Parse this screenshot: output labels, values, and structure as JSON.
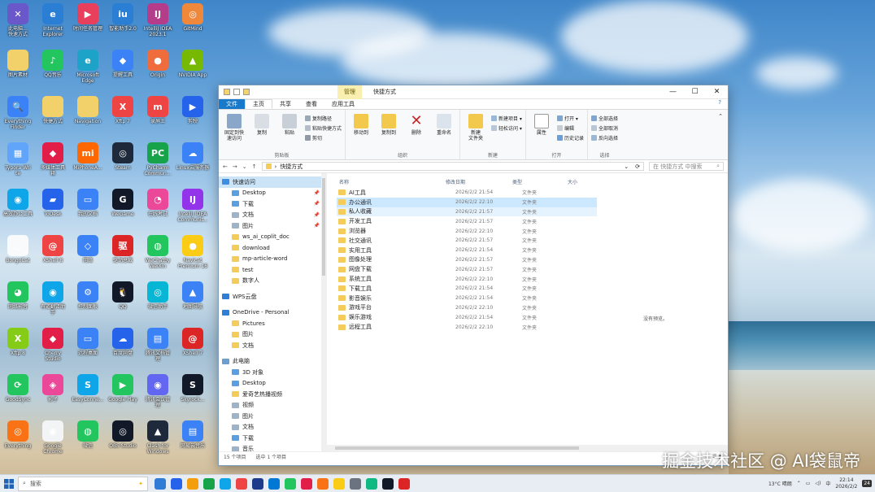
{
  "desktop_icons": [
    {
      "label": "此电脑…\n快速方式",
      "color": "#6a57c9",
      "glyph": "✕"
    },
    {
      "label": "Internet\nExplorer",
      "color": "#2a7fd4",
      "glyph": "e"
    },
    {
      "label": "时间任务管理",
      "color": "#e8405c",
      "glyph": "▶"
    },
    {
      "label": "智能助手2.0",
      "color": "#2a7fd4",
      "glyph": "iu"
    },
    {
      "label": "IntelliJ IDEA\n2023.1",
      "color": "#b43c8a",
      "glyph": "IJ"
    },
    {
      "label": "GitMind",
      "color": "#f0883c",
      "glyph": "◎"
    },
    {
      "label": "图片素材",
      "color": "#f2d16b",
      "glyph": ""
    },
    {
      "label": "QQ音乐",
      "color": "#22c55e",
      "glyph": "♪"
    },
    {
      "label": "Microsoft\nEdge",
      "color": "#1ea3c8",
      "glyph": "e"
    },
    {
      "label": "提醒工具",
      "color": "#3b82f6",
      "glyph": "◆"
    },
    {
      "label": "Origin",
      "color": "#ef6c3c",
      "glyph": "●"
    },
    {
      "label": "NVIDIA App",
      "color": "#76b900",
      "glyph": "▲"
    },
    {
      "label": "Everything\nFinder",
      "color": "#3b82f6",
      "glyph": "🔍"
    },
    {
      "label": "快捷方式",
      "color": "#f2d16b",
      "glyph": ""
    },
    {
      "label": "Navigation",
      "color": "#f2d16b",
      "glyph": ""
    },
    {
      "label": "Xftp 7",
      "color": "#ef4444",
      "glyph": "X"
    },
    {
      "label": "录屏王",
      "color": "#ef4444",
      "glyph": "m"
    },
    {
      "label": "剪映",
      "color": "#2563eb",
      "glyph": "▶"
    },
    {
      "label": "Typora Wri\nte",
      "color": "#60a5fa",
      "glyph": "▦"
    },
    {
      "label": "多媒体工具\n箱",
      "color": "#e11d48",
      "glyph": "◆"
    },
    {
      "label": "MiPhoneA...",
      "color": "#ff6700",
      "glyph": "mi"
    },
    {
      "label": "Steam",
      "color": "#1e293b",
      "glyph": "◎"
    },
    {
      "label": "PyCharm\nCommun...",
      "color": "#16a34a",
      "glyph": "PC"
    },
    {
      "label": "Linux云服务器",
      "color": "#3b82f6",
      "glyph": "☁"
    },
    {
      "label": "高效办公工具",
      "color": "#0ea5e9",
      "glyph": "◉"
    },
    {
      "label": "ToDesk",
      "color": "#2563eb",
      "glyph": "▰"
    },
    {
      "label": "我的文档",
      "color": "#3b82f6",
      "glyph": "▭"
    },
    {
      "label": "WeGame",
      "color": "#111827",
      "glyph": "G"
    },
    {
      "label": "在线考试",
      "color": "#ec4899",
      "glyph": "◔"
    },
    {
      "label": "IntelliJ IDEA\nCommunit...",
      "color": "#9333ea",
      "glyph": "IJ"
    },
    {
      "label": "BongoCat",
      "color": "#f9fafb",
      "glyph": "◡"
    },
    {
      "label": "XShell 8",
      "color": "#ef4444",
      "glyph": "@"
    },
    {
      "label": "网络",
      "color": "#3b82f6",
      "glyph": "◇"
    },
    {
      "label": "驱动总裁",
      "color": "#dc2626",
      "glyph": "驱"
    },
    {
      "label": "WeChatby\nWeiXin",
      "color": "#22c55e",
      "glyph": "◍"
    },
    {
      "label": "Navicat\nPremium 16",
      "color": "#facc15",
      "glyph": "●"
    },
    {
      "label": "网络影音",
      "color": "#22c55e",
      "glyph": "◕"
    },
    {
      "label": "有道翻译助\n手",
      "color": "#0ea5e9",
      "glyph": "◉"
    },
    {
      "label": "控制面板",
      "color": "#3b82f6",
      "glyph": "⚙"
    },
    {
      "label": "QQ",
      "color": "#111827",
      "glyph": "🐧"
    },
    {
      "label": "微信助手",
      "color": "#06b6d4",
      "glyph": "◎"
    },
    {
      "label": "地图导航",
      "color": "#3b82f6",
      "glyph": "▲"
    },
    {
      "label": "Xftp 8",
      "color": "#84cc16",
      "glyph": "X"
    },
    {
      "label": "Cherry\nStudio",
      "color": "#e11d48",
      "glyph": "◆"
    },
    {
      "label": "远程桌面",
      "color": "#3b82f6",
      "glyph": "▭"
    },
    {
      "label": "百度网盘",
      "color": "#2563eb",
      "glyph": "☁"
    },
    {
      "label": "腾讯文档管\n理",
      "color": "#3b82f6",
      "glyph": "▤"
    },
    {
      "label": "XShell 7",
      "color": "#dc2626",
      "glyph": "@"
    },
    {
      "label": "GoodSync",
      "color": "#22c55e",
      "glyph": "⟳"
    },
    {
      "label": "影子",
      "color": "#ec4899",
      "glyph": "◈"
    },
    {
      "label": "EasyConne...",
      "color": "#0ea5e9",
      "glyph": "S"
    },
    {
      "label": "Google Play",
      "color": "#22c55e",
      "glyph": "▶"
    },
    {
      "label": "腾讯会议管\n理",
      "color": "#6366f1",
      "glyph": "◉"
    },
    {
      "label": "Skyrock...",
      "color": "#111827",
      "glyph": "S"
    },
    {
      "label": "Everything",
      "color": "#f97316",
      "glyph": "◎"
    },
    {
      "label": "Google\nChrome",
      "color": "#f3f4f6",
      "glyph": "◉"
    },
    {
      "label": "微信",
      "color": "#22c55e",
      "glyph": "◍"
    },
    {
      "label": "OBS Studio",
      "color": "#111827",
      "glyph": "◎"
    },
    {
      "label": "Clash for\nWindows",
      "color": "#1e293b",
      "glyph": "▲"
    },
    {
      "label": "网易云音乐",
      "color": "#3b82f6",
      "glyph": "▤"
    }
  ],
  "window": {
    "context_tab": "管理",
    "title": "快捷方式",
    "controls": [
      "—",
      "☐",
      "✕"
    ],
    "tabs": [
      "文件",
      "主页",
      "共享",
      "查看",
      "应用工具"
    ],
    "ribbon": {
      "clipboard": {
        "name": "剪贴板",
        "pin": "固定到快\n速访问",
        "copy": "复制",
        "paste": "粘贴",
        "small": [
          "复制路径",
          "粘贴快捷方式",
          "剪切"
        ]
      },
      "organize": {
        "name": "组织",
        "move": "移动到",
        "copyto": "复制到",
        "delete": "删除",
        "rename": "重命名"
      },
      "new": {
        "name": "新建",
        "folder": "新建\n文件夹",
        "small": [
          "新建项目 ▾",
          "轻松访问 ▾"
        ]
      },
      "open": {
        "name": "打开",
        "props": "属性",
        "small": [
          "打开 ▾",
          "编辑",
          "历史记录"
        ]
      },
      "select": {
        "name": "选择",
        "small": [
          "全部选择",
          "全部取消",
          "反向选择"
        ]
      }
    },
    "address": {
      "path": "快捷方式",
      "search_placeholder": "在 快捷方式 中搜索"
    },
    "nav": [
      {
        "label": "快速访问",
        "type": "star",
        "sel": true,
        "pin": ""
      },
      {
        "label": "Desktop",
        "type": "blue",
        "pin": "📌"
      },
      {
        "label": "下载",
        "type": "blue",
        "pin": "📌"
      },
      {
        "label": "文档",
        "type": "doc",
        "pin": "📌"
      },
      {
        "label": "图片",
        "type": "doc",
        "pin": "📌"
      },
      {
        "label": "ws_ai_coplit_doc",
        "type": "folder",
        "pin": ""
      },
      {
        "label": "download",
        "type": "folder",
        "pin": ""
      },
      {
        "label": "mp-article-word",
        "type": "folder",
        "pin": ""
      },
      {
        "label": "test",
        "type": "folder",
        "pin": ""
      },
      {
        "label": "数字人",
        "type": "folder",
        "pin": ""
      },
      {
        "label": "",
        "type": "gap",
        "pin": ""
      },
      {
        "label": "WPS云盘",
        "type": "cloud",
        "pin": ""
      },
      {
        "label": "",
        "type": "gap",
        "pin": ""
      },
      {
        "label": "OneDrive - Personal",
        "type": "cloud",
        "pin": ""
      },
      {
        "label": "Pictures",
        "type": "folder",
        "pin": ""
      },
      {
        "label": "图片",
        "type": "folder",
        "pin": ""
      },
      {
        "label": "文档",
        "type": "folder",
        "pin": ""
      },
      {
        "label": "",
        "type": "gap",
        "pin": ""
      },
      {
        "label": "此电脑",
        "type": "pc",
        "pin": ""
      },
      {
        "label": "3D 对象",
        "type": "blue",
        "pin": ""
      },
      {
        "label": "Desktop",
        "type": "blue",
        "pin": ""
      },
      {
        "label": "爱奇艺热播视频",
        "type": "folder",
        "pin": ""
      },
      {
        "label": "视频",
        "type": "doc",
        "pin": ""
      },
      {
        "label": "图片",
        "type": "doc",
        "pin": ""
      },
      {
        "label": "文档",
        "type": "doc",
        "pin": ""
      },
      {
        "label": "下载",
        "type": "blue",
        "pin": ""
      },
      {
        "label": "音乐",
        "type": "doc",
        "pin": ""
      }
    ],
    "columns": {
      "name": "名称",
      "date": "修改日期",
      "type": "类型",
      "size": "大小"
    },
    "files": [
      {
        "name": "AI工具",
        "date": "2026/2/2 21:54",
        "type": "文件夹",
        "state": ""
      },
      {
        "name": "办公通讯",
        "date": "2026/2/2 22:10",
        "type": "文件夹",
        "state": "sel"
      },
      {
        "name": "私人收藏",
        "date": "2026/2/2 21:57",
        "type": "文件夹",
        "state": "hov"
      },
      {
        "name": "开发工具",
        "date": "2026/2/2 21:57",
        "type": "文件夹",
        "state": ""
      },
      {
        "name": "浏览器",
        "date": "2026/2/2 22:10",
        "type": "文件夹",
        "state": ""
      },
      {
        "name": "社交通讯",
        "date": "2026/2/2 21:57",
        "type": "文件夹",
        "state": ""
      },
      {
        "name": "实用工具",
        "date": "2026/2/2 21:54",
        "type": "文件夹",
        "state": ""
      },
      {
        "name": "图像处理",
        "date": "2026/2/2 21:57",
        "type": "文件夹",
        "state": ""
      },
      {
        "name": "网盘下载",
        "date": "2026/2/2 21:57",
        "type": "文件夹",
        "state": ""
      },
      {
        "name": "系统工具",
        "date": "2026/2/2 22:10",
        "type": "文件夹",
        "state": ""
      },
      {
        "name": "下载工具",
        "date": "2026/2/2 21:54",
        "type": "文件夹",
        "state": ""
      },
      {
        "name": "影音娱乐",
        "date": "2026/2/2 21:54",
        "type": "文件夹",
        "state": ""
      },
      {
        "name": "游戏平台",
        "date": "2026/2/2 22:10",
        "type": "文件夹",
        "state": ""
      },
      {
        "name": "娱乐游戏",
        "date": "2026/2/2 21:54",
        "type": "文件夹",
        "state": ""
      },
      {
        "name": "远程工具",
        "date": "2026/2/2 22:10",
        "type": "文件夹",
        "state": ""
      }
    ],
    "preview_text": "没有预览。",
    "status": {
      "count": "15 个项目",
      "selected": "选中 1 个项目"
    }
  },
  "taskbar": {
    "search_placeholder": "搜索",
    "apps": [
      "#2f7bd6",
      "#2563eb",
      "#f59e0b",
      "#16a34a",
      "#0ea5e9",
      "#ef4444",
      "#1e3a8a",
      "#0078d4",
      "#22c55e",
      "#e11d48",
      "#f97316",
      "#facc15",
      "#6b7280",
      "#10b981",
      "#111827",
      "#dc2626"
    ],
    "weather": "13°C 晴朗",
    "time": "22:14",
    "date": "2026/2/2",
    "notif": "24"
  },
  "watermark": "掘金技术社区 @ AI袋鼠帝"
}
